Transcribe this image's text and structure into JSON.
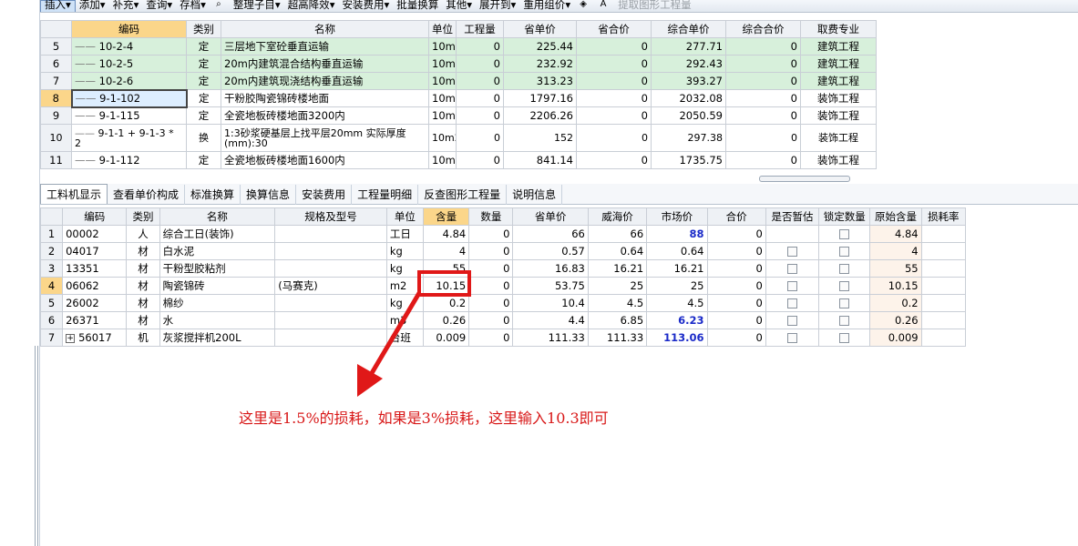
{
  "toolbar": {
    "items": [
      {
        "label": "插入",
        "arrow": "▾",
        "active": true
      },
      {
        "label": "添加",
        "arrow": "▾"
      },
      {
        "label": "补充",
        "arrow": "▾"
      },
      {
        "label": "查询",
        "arrow": "▾"
      },
      {
        "label": "存档",
        "arrow": "▾"
      },
      {
        "label": "",
        "icon": "binoculars-icon"
      },
      {
        "label": "整理子目",
        "arrow": "▾"
      },
      {
        "label": "超高降效",
        "arrow": "▾"
      },
      {
        "label": "安装费用",
        "arrow": "▾"
      },
      {
        "label": "批量换算",
        "arrow": ""
      },
      {
        "label": "其他",
        "arrow": "▾"
      },
      {
        "label": "展开到",
        "arrow": "▾"
      },
      {
        "label": "重用组价",
        "arrow": "▾"
      },
      {
        "label": "",
        "icon": "fill-color-icon"
      },
      {
        "label": "",
        "icon": "font-color-icon"
      },
      {
        "label": "提取图形工程量",
        "arrow": "",
        "disabled": true
      }
    ]
  },
  "upper_table": {
    "headers": [
      "编码",
      "类别",
      "名称",
      "单位",
      "工程量",
      "省单价",
      "省合价",
      "综合单价",
      "综合合价",
      "取费专业"
    ],
    "rows": [
      {
        "n": "5",
        "code": "10-2-4",
        "type": "定",
        "name": "三层地下室砼垂直运输",
        "unit": "10m2",
        "qty": "0",
        "price": "225.44",
        "total": "0",
        "comp_price": "277.71",
        "comp_total": "0",
        "spec": "建筑工程",
        "green": true
      },
      {
        "n": "6",
        "code": "10-2-5",
        "type": "定",
        "name": "20m内建筑混合结构垂直运输",
        "unit": "10m2",
        "qty": "0",
        "price": "232.92",
        "total": "0",
        "comp_price": "292.43",
        "comp_total": "0",
        "spec": "建筑工程",
        "green": true
      },
      {
        "n": "7",
        "code": "10-2-6",
        "type": "定",
        "name": "20m内建筑现浇结构垂直运输",
        "unit": "10m2",
        "qty": "0",
        "price": "313.23",
        "total": "0",
        "comp_price": "393.27",
        "comp_total": "0",
        "spec": "建筑工程",
        "green": true
      },
      {
        "n": "8",
        "code": "9-1-102",
        "type": "定",
        "name": "干粉胶陶瓷锦砖楼地面",
        "unit": "10m2",
        "qty": "0",
        "price": "1797.16",
        "total": "0",
        "comp_price": "2032.08",
        "comp_total": "0",
        "spec": "装饰工程",
        "selected": true
      },
      {
        "n": "9",
        "code": "9-1-115",
        "type": "定",
        "name": "全瓷地板砖楼地面3200内",
        "unit": "10m2",
        "qty": "0",
        "price": "2206.26",
        "total": "0",
        "comp_price": "2050.59",
        "comp_total": "0",
        "spec": "装饰工程"
      },
      {
        "n": "10",
        "code": "9-1-1 + 9-1-3 * 2",
        "type": "换",
        "name": "1:3砂浆硬基层上找平层20mm  实际厚度(mm):30",
        "unit": "10m2",
        "qty": "0",
        "price": "152",
        "total": "0",
        "comp_price": "297.38",
        "comp_total": "0",
        "spec": "装饰工程",
        "tall": true
      },
      {
        "n": "11",
        "code": "9-1-112",
        "type": "定",
        "name": "全瓷地板砖楼地面1600内",
        "unit": "10m2",
        "qty": "0",
        "price": "841.14",
        "total": "0",
        "comp_price": "1735.75",
        "comp_total": "0",
        "spec": "装饰工程"
      }
    ]
  },
  "tabs": [
    "工料机显示",
    "查看单价构成",
    "标准换算",
    "换算信息",
    "安装费用",
    "工程量明细",
    "反查图形工程量",
    "说明信息"
  ],
  "lower_table": {
    "headers": [
      "编码",
      "类别",
      "名称",
      "规格及型号",
      "单位",
      "含量",
      "数量",
      "省单价",
      "威海价",
      "市场价",
      "合价",
      "是否暂估",
      "锁定数量",
      "原始含量",
      "损耗率"
    ],
    "rows": [
      {
        "n": "1",
        "code": "00002",
        "type": "人",
        "name": "综合工日(装饰)",
        "spec": "",
        "unit": "工日",
        "content": "4.84",
        "amount": "0",
        "price": "66",
        "weihai": "66",
        "market": "88",
        "market_blue": true,
        "total": "0",
        "checks": false,
        "orig": "4.84"
      },
      {
        "n": "2",
        "code": "04017",
        "type": "材",
        "name": "白水泥",
        "spec": "",
        "unit": "kg",
        "content": "4",
        "amount": "0",
        "price": "0.57",
        "weihai": "0.64",
        "market": "0.64",
        "total": "0",
        "checks": true,
        "orig": "4"
      },
      {
        "n": "3",
        "code": "13351",
        "type": "材",
        "name": "干粉型胶粘剂",
        "spec": "",
        "unit": "kg",
        "content": "55",
        "amount": "0",
        "price": "16.83",
        "weihai": "16.21",
        "market": "16.21",
        "total": "0",
        "checks": true,
        "orig": "55"
      },
      {
        "n": "4",
        "code": "06062",
        "type": "材",
        "name": "陶瓷锦砖",
        "spec": "(马赛克)",
        "unit": "m2",
        "content": "10.15",
        "amount": "0",
        "price": "53.75",
        "weihai": "25",
        "market": "25",
        "total": "0",
        "checks": true,
        "orig": "10.15",
        "selected": true
      },
      {
        "n": "5",
        "code": "26002",
        "type": "材",
        "name": "棉纱",
        "spec": "",
        "unit": "kg",
        "content": "0.2",
        "amount": "0",
        "price": "10.4",
        "weihai": "4.5",
        "market": "4.5",
        "total": "0",
        "checks": true,
        "orig": "0.2"
      },
      {
        "n": "6",
        "code": "26371",
        "type": "材",
        "name": "水",
        "spec": "",
        "unit": "m3",
        "content": "0.26",
        "amount": "0",
        "price": "4.4",
        "weihai": "6.85",
        "market": "6.23",
        "market_blue": true,
        "total": "0",
        "checks": true,
        "orig": "0.26"
      },
      {
        "n": "7",
        "code": "56017",
        "type": "机",
        "name": "灰浆搅拌机200L",
        "spec": "",
        "unit": "台班",
        "content": "0.009",
        "amount": "0",
        "price": "111.33",
        "weihai": "111.33",
        "market": "113.06",
        "market_blue": true,
        "total": "0",
        "checks": true,
        "orig": "0.009",
        "expandable": true
      }
    ]
  },
  "annotation": "这里是1.5%的损耗，如果是3%损耗，这里输入10.3即可",
  "colors": {
    "accent": "#e01818",
    "selected_header": "#fbd68a",
    "green_row": "#d7f0db",
    "blue_price": "#1a2ac8"
  }
}
